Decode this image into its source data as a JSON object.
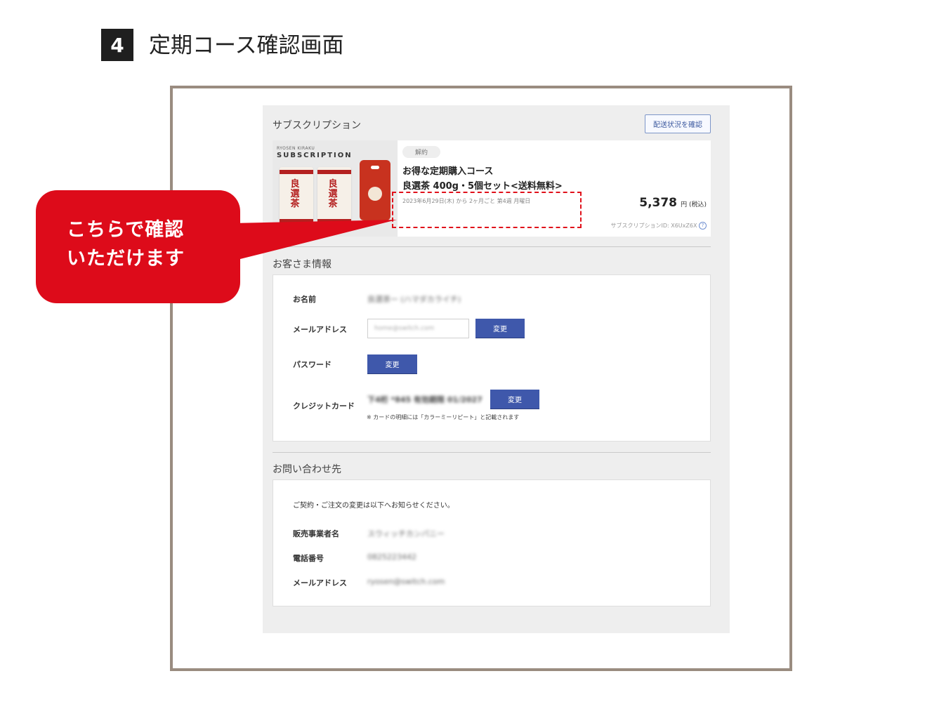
{
  "header": {
    "step_number": "4",
    "title": "定期コース確認画面"
  },
  "subscription": {
    "section_label": "サブスクリプション",
    "delivery_button": "配送状況を確認",
    "product_image": {
      "brand_small": "RYOSEN KIRAKU",
      "brand_large": "SUBSCRIPTION",
      "bag_label": "良選茶"
    },
    "cancel_tag": "解約",
    "course_name": "お得な定期購入コース",
    "product_name": "良選茶 400g・5個セット<送料無料>",
    "schedule": "2023年6月29日(木) から 2ヶ月ごと 第4週 月曜日",
    "price": "5,378",
    "price_unit": "円 (税込)",
    "subscription_id": "サブスクリプションID: X6UxZ6X"
  },
  "customer": {
    "section_label": "お客さま情報",
    "name_label": "お名前",
    "name_value": "良選茶ー (ハマダカライチ)",
    "email_label": "メールアドレス",
    "email_value": "home@switch.com",
    "email_change": "変更",
    "password_label": "パスワード",
    "password_change": "変更",
    "card_label": "クレジットカード",
    "card_value": "下4桁 *845  有効期限 01/2027",
    "card_change": "変更",
    "card_note": "※ カードの明細には「カラーミーリピート」と記載されます"
  },
  "contact": {
    "section_label": "お問い合わせ先",
    "intro": "ご契約・ご注文の変更は以下へお知らせください。",
    "seller_label": "販売事業者名",
    "seller_value": "スウィッチカンパニー",
    "phone_label": "電話番号",
    "phone_value": "0825223442",
    "email_label": "メールアドレス",
    "email_value": "ryosen@switch.com"
  },
  "callout": {
    "line1": "こちらで確認",
    "line2": "いただけます"
  },
  "colors": {
    "accent_red": "#dd0b1a",
    "button_blue": "#3f58ab",
    "frame": "#9a8c80"
  }
}
